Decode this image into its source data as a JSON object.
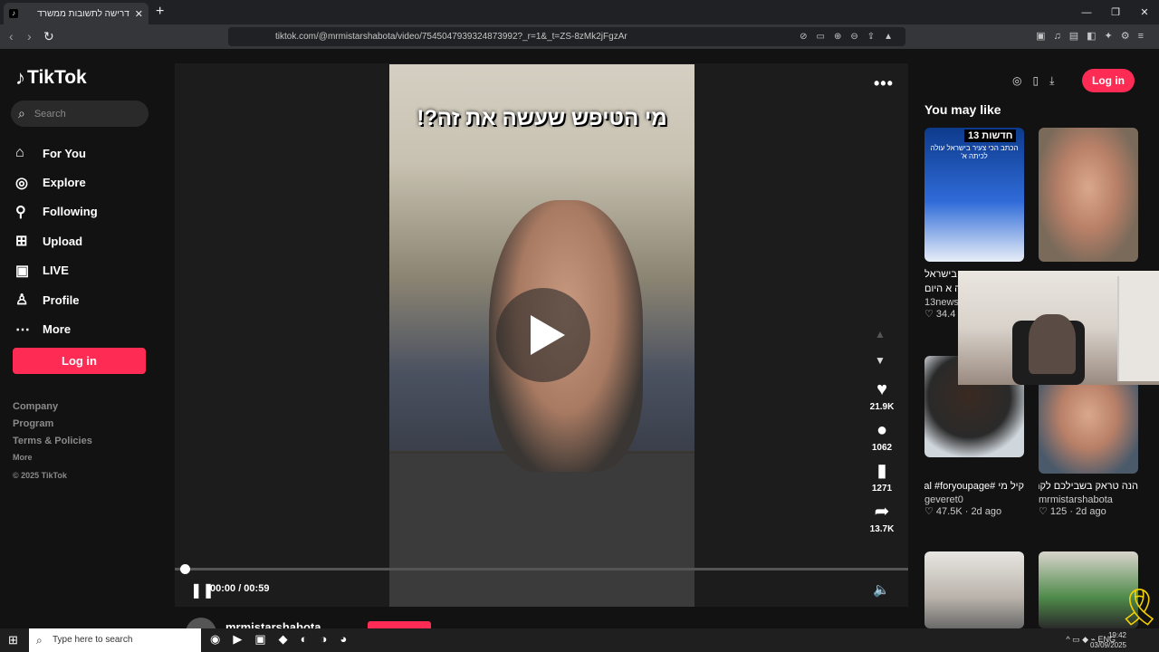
{
  "browser": {
    "tab_title": "דרישה לתשובות ממשרד החינוך",
    "tab_close": "✕",
    "new_tab": "+",
    "url": "tiktok.com/@mrmistarshabota/video/7545047939324873992?_r=1&_t=ZS-8zMk2jFgzAr",
    "window_controls": [
      "—",
      "❐",
      "✕"
    ]
  },
  "sidebar": {
    "brand": "TikTok",
    "search_placeholder": "Search",
    "nav": [
      {
        "label": "For You",
        "icon": "home-icon"
      },
      {
        "label": "Explore",
        "icon": "compass-icon"
      },
      {
        "label": "Following",
        "icon": "user-plus-icon"
      },
      {
        "label": "Upload",
        "icon": "plus-square-icon"
      },
      {
        "label": "LIVE",
        "icon": "tv-icon"
      },
      {
        "label": "Profile",
        "icon": "user-icon"
      },
      {
        "label": "More",
        "icon": "dots-icon"
      }
    ],
    "login_label": "Log in",
    "footer": {
      "company": "Company",
      "program": "Program",
      "terms": "Terms & Policies",
      "more": "More",
      "copyright": "© 2025 TikTok"
    }
  },
  "player": {
    "caption": "מי הטיפש שעשה את זה?!",
    "time": "00:00 / 00:59",
    "progress_fraction": 0.0,
    "actions": {
      "likes": "21.9K",
      "comments": "1062",
      "saves": "1271",
      "shares": "13.7K"
    },
    "author": "mrmistarshabota"
  },
  "topright": {
    "login_label": "Log in"
  },
  "recommendations": {
    "heading": "You may like",
    "items": [
      {
        "desc": "הכתב הכי צעיר בישראל עולה לכיתה א היום",
        "author": "13newsi",
        "stats": "34.4",
        "news_label": "חדשות 13",
        "news_sub": "הכתב הכי צעיר בישראל עולה לכיתה א'"
      },
      {
        "desc": "",
        "author": "",
        "stats": ""
      },
      {
        "desc": "קיל מי #foryou #fypシ viral #foryoupage...",
        "author": "geveret0",
        "stats": "47.5K · 2d ago"
      },
      {
        "desc": "הנה טראק בשבילכם לקראת שנת הלימודים!",
        "author": "mrmistarshabota",
        "stats": "125 · 2d ago"
      }
    ]
  },
  "taskbar": {
    "search_placeholder": "Type here to search",
    "lang": "ENG",
    "time": "19:42",
    "date": "03/09/2025"
  }
}
